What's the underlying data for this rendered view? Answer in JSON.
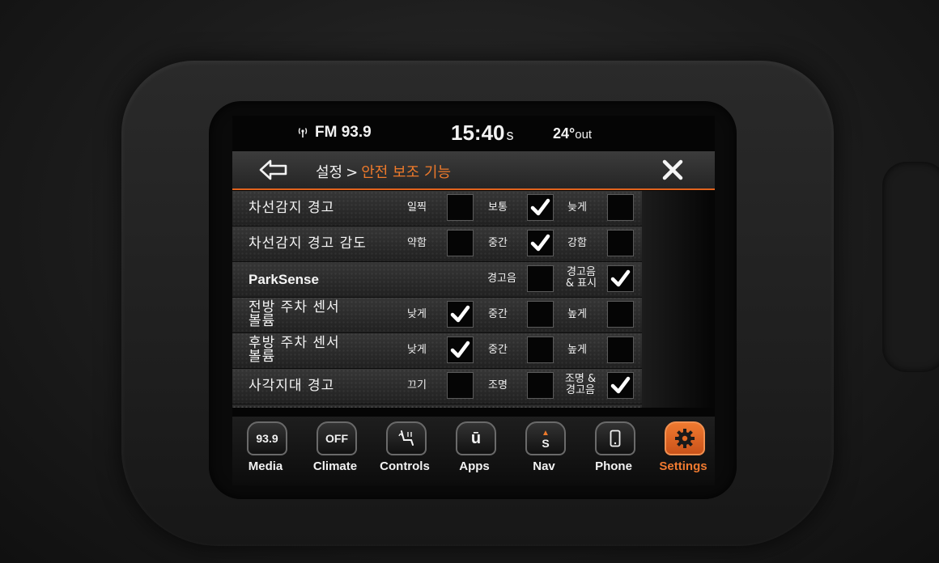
{
  "status": {
    "radio": "FM 93.9",
    "time": "15:40",
    "time_suffix": "s",
    "temperature": "24°",
    "temp_suffix": "out"
  },
  "header": {
    "crumb_parent": "설정",
    "crumb_sep": ">",
    "crumb_current": "안전 보조 기능"
  },
  "rows": [
    {
      "label": "차선감지 경고",
      "options": [
        {
          "label": "일찍",
          "checked": false
        },
        {
          "label": "보통",
          "checked": true
        },
        {
          "label": "늦게",
          "checked": false
        }
      ]
    },
    {
      "label": "차선감지 경고 감도",
      "options": [
        {
          "label": "약함",
          "checked": false
        },
        {
          "label": "중간",
          "checked": true
        },
        {
          "label": "강함",
          "checked": false
        }
      ]
    },
    {
      "label": "ParkSense",
      "options": [
        {
          "label": "경고음",
          "checked": false
        },
        {
          "label_line1": "경고음",
          "label_line2": "& 표시",
          "checked": true
        }
      ]
    },
    {
      "label_line1": "전방 주차 센서",
      "label_line2": "볼륨",
      "options": [
        {
          "label": "낮게",
          "checked": true
        },
        {
          "label": "중간",
          "checked": false
        },
        {
          "label": "높게",
          "checked": false
        }
      ]
    },
    {
      "label_line1": "후방 주차 센서",
      "label_line2": "볼륨",
      "options": [
        {
          "label": "낮게",
          "checked": true
        },
        {
          "label": "중간",
          "checked": false
        },
        {
          "label": "높게",
          "checked": false
        }
      ]
    },
    {
      "label": "사각지대 경고",
      "options": [
        {
          "label": "끄기",
          "checked": false
        },
        {
          "label": "조명",
          "checked": false
        },
        {
          "label_line1": "조명 &",
          "label_line2": "경고음",
          "checked": true
        }
      ]
    }
  ],
  "nav": {
    "media_badge": "93.9",
    "media": "Media",
    "climate_badge": "OFF",
    "climate": "Climate",
    "controls": "Controls",
    "apps_badge": "ū",
    "apps": "Apps",
    "nav_badge": "S",
    "nav": "Nav",
    "phone": "Phone",
    "settings": "Settings"
  },
  "colors": {
    "accent": "#ee7a2b",
    "check": "#ffffff"
  }
}
